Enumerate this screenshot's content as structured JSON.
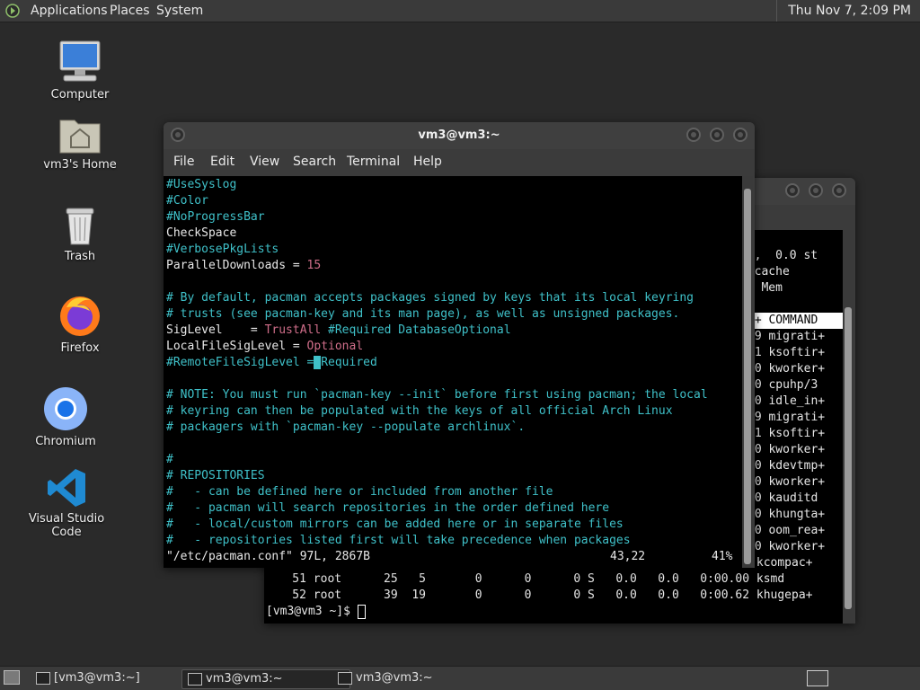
{
  "top_panel": {
    "menus": [
      "Applications",
      "Places",
      "System"
    ],
    "clock": "Thu Nov 7, 2:09 PM"
  },
  "desktop_icons": [
    {
      "label": "Computer",
      "icon": "computer-icon"
    },
    {
      "label": "vm3's Home",
      "icon": "home-folder-icon"
    },
    {
      "label": "Trash",
      "icon": "trash-icon"
    },
    {
      "label": "Firefox",
      "icon": "firefox-icon"
    },
    {
      "label": "Chromium",
      "icon": "chromium-icon"
    },
    {
      "label": "Visual Studio Code",
      "icon": "vscode-icon"
    }
  ],
  "front_window": {
    "title": "vm3@vm3:~",
    "menu": [
      "File",
      "Edit",
      "View",
      "Search",
      "Terminal",
      "Help"
    ],
    "lines": [
      "#UseSyslog",
      "#Color",
      "#NoProgressBar",
      "CheckSpace",
      "#VerbosePkgLists",
      "ParallelDownloads = 15",
      "",
      "# By default, pacman accepts packages signed by keys that its local keyring",
      "# trusts (see pacman-key and its man page), as well as unsigned packages.",
      "SigLevel    = TrustAll #Required DatabaseOptional",
      "LocalFileSigLevel = Optional",
      "#RemoteFileSigLevel = Required",
      "",
      "# NOTE: You must run `pacman-key --init` before first using pacman; the local",
      "# keyring can then be populated with the keys of all official Arch Linux",
      "# packagers with `pacman-key --populate archlinux`.",
      "",
      "#",
      "# REPOSITORIES",
      "#   - can be defined here or included from another file",
      "#   - pacman will search repositories in the order defined here",
      "#   - local/custom mirrors can be added here or in separate files",
      "#   - repositories listed first will take precedence when packages"
    ],
    "status": {
      "file": "\"/etc/pacman.conf\" 97L, 2867B",
      "position": "43,22",
      "percent": "41%"
    }
  },
  "back_window": {
    "visible_right_lines": [
      "si,  0.0 st",
      "f/cache",
      "il Mem",
      "",
      "E+ COMMAND",
      "29 migrati+",
      "01 ksoftir+",
      "00 kworker+",
      "00 cpuhp/3",
      "00 idle_in+",
      "29 migrati+",
      "01 ksoftir+",
      "00 kworker+",
      "00 kdevtmp+",
      "00 kworker+",
      "00 kauditd",
      "00 khungta+",
      "00 oom_rea+",
      "00 kworker+",
      "09 kcompac+"
    ],
    "bottom_rows": [
      "    51 root      25   5       0      0      0 S   0.0   0.0   0:00.00 ksmd",
      "    52 root      39  19       0      0      0 S   0.0   0.0   0:00.62 khugepa+"
    ],
    "partial_row": "    50 root      25   5       0      0      0 S   0.0   0.0   0:00.09 kcompac+",
    "prompt": "[vm3@vm3 ~]$ "
  },
  "taskbar": {
    "items": [
      "[vm3@vm3:~]",
      "vm3@vm3:~",
      "vm3@vm3:~"
    ]
  },
  "colors": {
    "comment": "#3fc1c9",
    "value": "#d06e8a",
    "terminal_bg": "#000000",
    "panel": "#3a3a3a"
  }
}
